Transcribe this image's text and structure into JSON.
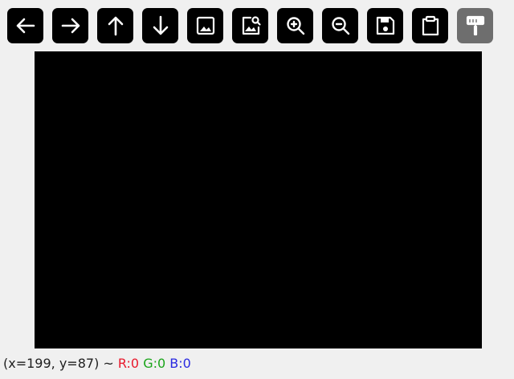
{
  "toolbar": {
    "buttons": [
      {
        "icon": "arrow-left-icon",
        "enabled": true
      },
      {
        "icon": "arrow-right-icon",
        "enabled": true
      },
      {
        "icon": "arrow-up-icon",
        "enabled": true
      },
      {
        "icon": "arrow-down-icon",
        "enabled": true
      },
      {
        "icon": "image-icon",
        "enabled": true
      },
      {
        "icon": "image-search-icon",
        "enabled": true
      },
      {
        "icon": "zoom-in-icon",
        "enabled": true
      },
      {
        "icon": "zoom-out-icon",
        "enabled": true
      },
      {
        "icon": "save-icon",
        "enabled": true
      },
      {
        "icon": "clipboard-icon",
        "enabled": true
      },
      {
        "icon": "paint-roller-icon",
        "enabled": false
      }
    ]
  },
  "canvas": {
    "color": "#000000"
  },
  "status": {
    "coords": "(x=199, y=87) ~",
    "r": "R:0",
    "g": "G:0",
    "b": "B:0",
    "colors": {
      "r": "#e8192c",
      "g": "#1aa51a",
      "b": "#2a2ae0"
    }
  }
}
